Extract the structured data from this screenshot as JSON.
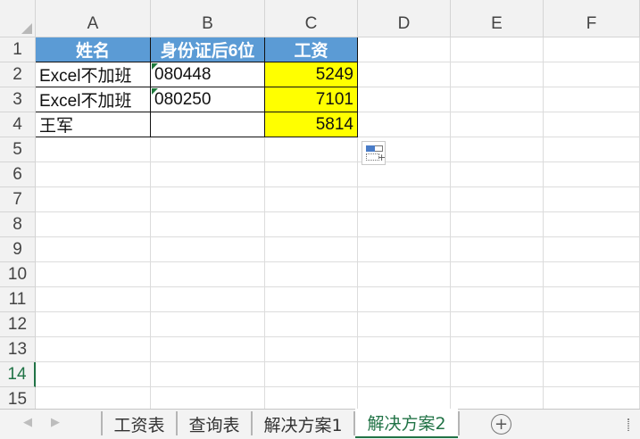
{
  "colors": {
    "header_fill": "#5b9bd5",
    "highlight_fill": "#ffff00",
    "active_green": "#217346"
  },
  "columns": [
    "A",
    "B",
    "C",
    "D",
    "E",
    "F"
  ],
  "rows": [
    "1",
    "2",
    "3",
    "4",
    "5",
    "6",
    "7",
    "8",
    "9",
    "10",
    "11",
    "12",
    "13",
    "14",
    "15"
  ],
  "selected_row": "14",
  "table": {
    "headers": [
      "姓名",
      "身份证后6位",
      "工资"
    ],
    "rows": [
      {
        "name": "Excel不加班",
        "id": "080448",
        "salary": "5249"
      },
      {
        "name": "Excel不加班",
        "id": "080250",
        "salary": "7101"
      },
      {
        "name": "王军",
        "id": "",
        "salary": "5814"
      }
    ]
  },
  "paste_options_icon": "paste-options-icon",
  "tabs": {
    "nav_prev": "◀",
    "nav_next": "▶",
    "sheets": [
      "工资表",
      "查询表",
      "解决方案1",
      "解决方案2"
    ],
    "active": "解决方案2",
    "add_symbol": "+"
  }
}
